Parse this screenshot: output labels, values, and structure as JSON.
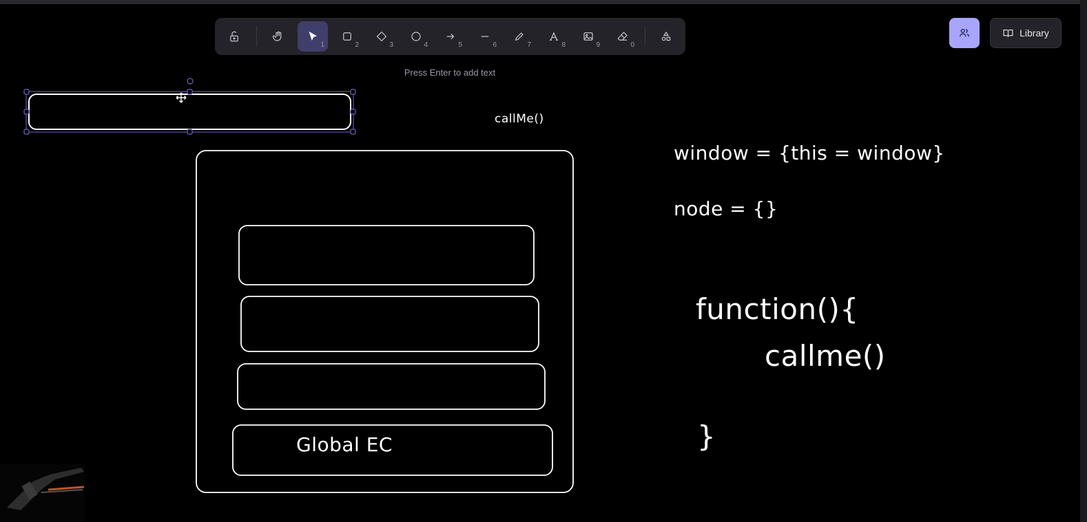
{
  "toolbar": {
    "tools": [
      {
        "name": "lock",
        "num": ""
      },
      {
        "name": "hand",
        "num": ""
      },
      {
        "name": "selection",
        "num": "1"
      },
      {
        "name": "rectangle",
        "num": "2"
      },
      {
        "name": "diamond",
        "num": "3"
      },
      {
        "name": "ellipse",
        "num": "4"
      },
      {
        "name": "arrow",
        "num": "5"
      },
      {
        "name": "line",
        "num": "6"
      },
      {
        "name": "draw",
        "num": "7"
      },
      {
        "name": "text",
        "num": "8"
      },
      {
        "name": "image",
        "num": "9"
      },
      {
        "name": "eraser",
        "num": "0"
      },
      {
        "name": "more-shapes",
        "num": ""
      }
    ],
    "active_tool": "selection"
  },
  "hint": "Press Enter to add text",
  "library_label": "Library",
  "canvas_text": {
    "callme_top": "callMe()",
    "window_line": "window = {this = window}",
    "node_line": "node = {}",
    "function_line": "function(){",
    "callme_inner": "callme()",
    "close_brace": "}",
    "global_ec": "Global EC"
  },
  "colors": {
    "background": "#000000",
    "toolbar": "#232329",
    "active_tool": "#403e6a",
    "accent": "#a8a5ff",
    "selection": "#6b63c9"
  }
}
